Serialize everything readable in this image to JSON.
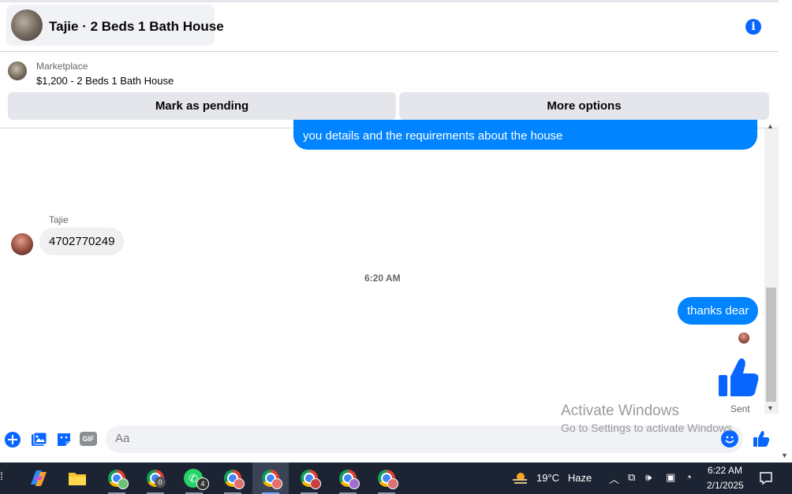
{
  "header": {
    "title": "Tajie · 2 Beds 1 Bath House",
    "info_icon": "info-icon"
  },
  "marketplace": {
    "label": "Marketplace",
    "listing": "$1,200 - 2 Beds 1 Bath House",
    "pending_label": "Mark as pending",
    "more_label": "More options"
  },
  "messages": {
    "partial_outgoing": "you details and the requirements about the house",
    "sender_name": "Tajie",
    "incoming": "4702770249",
    "timestamp": "6:20 AM",
    "outgoing": "thanks dear",
    "status": "Sent"
  },
  "composer": {
    "placeholder": "Aa",
    "icons": [
      "add-icon",
      "photo-icon",
      "sticker-icon",
      "gif-icon",
      "emoji-icon",
      "thumbs-up-icon"
    ],
    "gif_label": "GIF"
  },
  "watermark": {
    "line1": "Activate Windows",
    "line2": "Go to Settings to activate Windows."
  },
  "taskbar": {
    "whatsapp_badge": "4",
    "chrome_badge": "0",
    "weather_temp": "19°C",
    "weather_desc": "Haze",
    "time": "6:22 AM",
    "date": "2/1/2025"
  },
  "colors": {
    "accent": "#0084ff",
    "messenger_blue": "#0866ff",
    "taskbar": "#1c2433"
  }
}
